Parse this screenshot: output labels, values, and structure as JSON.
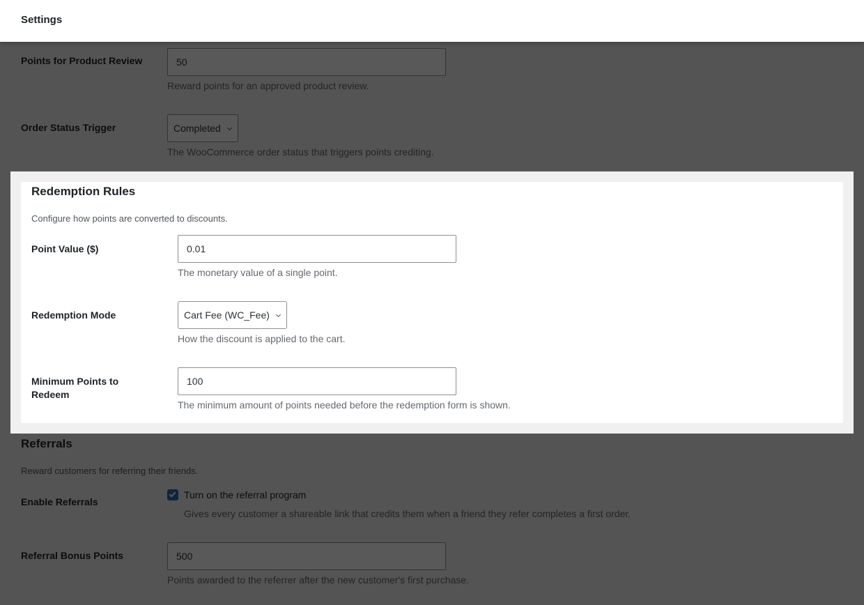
{
  "header": {
    "title": "Settings"
  },
  "earning": {
    "product_review": {
      "label": "Points for Product Review",
      "value": "50",
      "description": "Reward points for an approved product review."
    },
    "order_status": {
      "label": "Order Status Trigger",
      "selected": "Completed",
      "description": "The WooCommerce order status that triggers points crediting."
    }
  },
  "redemption": {
    "title": "Redemption Rules",
    "description": "Configure how points are converted to discounts.",
    "point_value": {
      "label": "Point Value ($)",
      "value": "0.01",
      "description": "The monetary value of a single point."
    },
    "mode": {
      "label": "Redemption Mode",
      "selected": "Cart Fee (WC_Fee)",
      "description": "How the discount is applied to the cart."
    },
    "minimum": {
      "label": "Minimum Points to Redeem",
      "value": "100",
      "description": "The minimum amount of points needed before the redemption form is shown."
    }
  },
  "referrals": {
    "title": "Referrals",
    "description": "Reward customers for referring their friends.",
    "enable": {
      "label": "Enable Referrals",
      "checkbox_label": "Turn on the referral program",
      "checked": true,
      "description": "Gives every customer a shareable link that credits them when a friend they refer completes a first order."
    },
    "bonus": {
      "label": "Referral Bonus Points",
      "value": "500",
      "description": "Points awarded to the referrer after the new customer's first purchase."
    }
  },
  "colors": {
    "accent": "#2271b1",
    "overlay": "rgba(0,0,0,0.65)",
    "background": "#f0f0f1"
  }
}
